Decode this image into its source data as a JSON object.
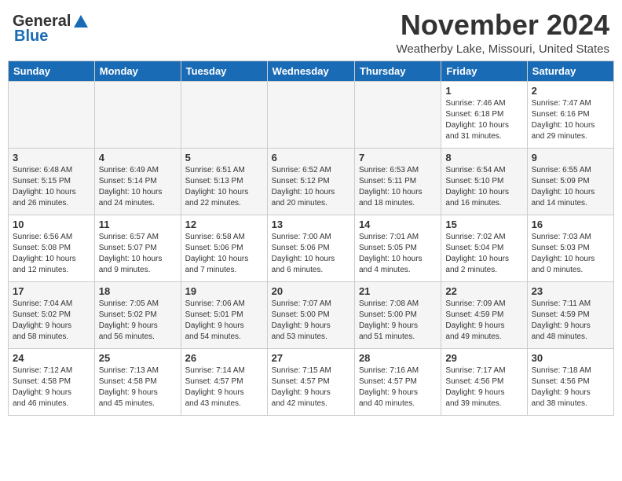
{
  "header": {
    "logo_general": "General",
    "logo_blue": "Blue",
    "month_title": "November 2024",
    "subtitle": "Weatherby Lake, Missouri, United States"
  },
  "calendar": {
    "days_of_week": [
      "Sunday",
      "Monday",
      "Tuesday",
      "Wednesday",
      "Thursday",
      "Friday",
      "Saturday"
    ],
    "weeks": [
      [
        {
          "day": "",
          "info": ""
        },
        {
          "day": "",
          "info": ""
        },
        {
          "day": "",
          "info": ""
        },
        {
          "day": "",
          "info": ""
        },
        {
          "day": "",
          "info": ""
        },
        {
          "day": "1",
          "info": "Sunrise: 7:46 AM\nSunset: 6:18 PM\nDaylight: 10 hours\nand 31 minutes."
        },
        {
          "day": "2",
          "info": "Sunrise: 7:47 AM\nSunset: 6:16 PM\nDaylight: 10 hours\nand 29 minutes."
        }
      ],
      [
        {
          "day": "3",
          "info": "Sunrise: 6:48 AM\nSunset: 5:15 PM\nDaylight: 10 hours\nand 26 minutes."
        },
        {
          "day": "4",
          "info": "Sunrise: 6:49 AM\nSunset: 5:14 PM\nDaylight: 10 hours\nand 24 minutes."
        },
        {
          "day": "5",
          "info": "Sunrise: 6:51 AM\nSunset: 5:13 PM\nDaylight: 10 hours\nand 22 minutes."
        },
        {
          "day": "6",
          "info": "Sunrise: 6:52 AM\nSunset: 5:12 PM\nDaylight: 10 hours\nand 20 minutes."
        },
        {
          "day": "7",
          "info": "Sunrise: 6:53 AM\nSunset: 5:11 PM\nDaylight: 10 hours\nand 18 minutes."
        },
        {
          "day": "8",
          "info": "Sunrise: 6:54 AM\nSunset: 5:10 PM\nDaylight: 10 hours\nand 16 minutes."
        },
        {
          "day": "9",
          "info": "Sunrise: 6:55 AM\nSunset: 5:09 PM\nDaylight: 10 hours\nand 14 minutes."
        }
      ],
      [
        {
          "day": "10",
          "info": "Sunrise: 6:56 AM\nSunset: 5:08 PM\nDaylight: 10 hours\nand 12 minutes."
        },
        {
          "day": "11",
          "info": "Sunrise: 6:57 AM\nSunset: 5:07 PM\nDaylight: 10 hours\nand 9 minutes."
        },
        {
          "day": "12",
          "info": "Sunrise: 6:58 AM\nSunset: 5:06 PM\nDaylight: 10 hours\nand 7 minutes."
        },
        {
          "day": "13",
          "info": "Sunrise: 7:00 AM\nSunset: 5:06 PM\nDaylight: 10 hours\nand 6 minutes."
        },
        {
          "day": "14",
          "info": "Sunrise: 7:01 AM\nSunset: 5:05 PM\nDaylight: 10 hours\nand 4 minutes."
        },
        {
          "day": "15",
          "info": "Sunrise: 7:02 AM\nSunset: 5:04 PM\nDaylight: 10 hours\nand 2 minutes."
        },
        {
          "day": "16",
          "info": "Sunrise: 7:03 AM\nSunset: 5:03 PM\nDaylight: 10 hours\nand 0 minutes."
        }
      ],
      [
        {
          "day": "17",
          "info": "Sunrise: 7:04 AM\nSunset: 5:02 PM\nDaylight: 9 hours\nand 58 minutes."
        },
        {
          "day": "18",
          "info": "Sunrise: 7:05 AM\nSunset: 5:02 PM\nDaylight: 9 hours\nand 56 minutes."
        },
        {
          "day": "19",
          "info": "Sunrise: 7:06 AM\nSunset: 5:01 PM\nDaylight: 9 hours\nand 54 minutes."
        },
        {
          "day": "20",
          "info": "Sunrise: 7:07 AM\nSunset: 5:00 PM\nDaylight: 9 hours\nand 53 minutes."
        },
        {
          "day": "21",
          "info": "Sunrise: 7:08 AM\nSunset: 5:00 PM\nDaylight: 9 hours\nand 51 minutes."
        },
        {
          "day": "22",
          "info": "Sunrise: 7:09 AM\nSunset: 4:59 PM\nDaylight: 9 hours\nand 49 minutes."
        },
        {
          "day": "23",
          "info": "Sunrise: 7:11 AM\nSunset: 4:59 PM\nDaylight: 9 hours\nand 48 minutes."
        }
      ],
      [
        {
          "day": "24",
          "info": "Sunrise: 7:12 AM\nSunset: 4:58 PM\nDaylight: 9 hours\nand 46 minutes."
        },
        {
          "day": "25",
          "info": "Sunrise: 7:13 AM\nSunset: 4:58 PM\nDaylight: 9 hours\nand 45 minutes."
        },
        {
          "day": "26",
          "info": "Sunrise: 7:14 AM\nSunset: 4:57 PM\nDaylight: 9 hours\nand 43 minutes."
        },
        {
          "day": "27",
          "info": "Sunrise: 7:15 AM\nSunset: 4:57 PM\nDaylight: 9 hours\nand 42 minutes."
        },
        {
          "day": "28",
          "info": "Sunrise: 7:16 AM\nSunset: 4:57 PM\nDaylight: 9 hours\nand 40 minutes."
        },
        {
          "day": "29",
          "info": "Sunrise: 7:17 AM\nSunset: 4:56 PM\nDaylight: 9 hours\nand 39 minutes."
        },
        {
          "day": "30",
          "info": "Sunrise: 7:18 AM\nSunset: 4:56 PM\nDaylight: 9 hours\nand 38 minutes."
        }
      ]
    ]
  }
}
